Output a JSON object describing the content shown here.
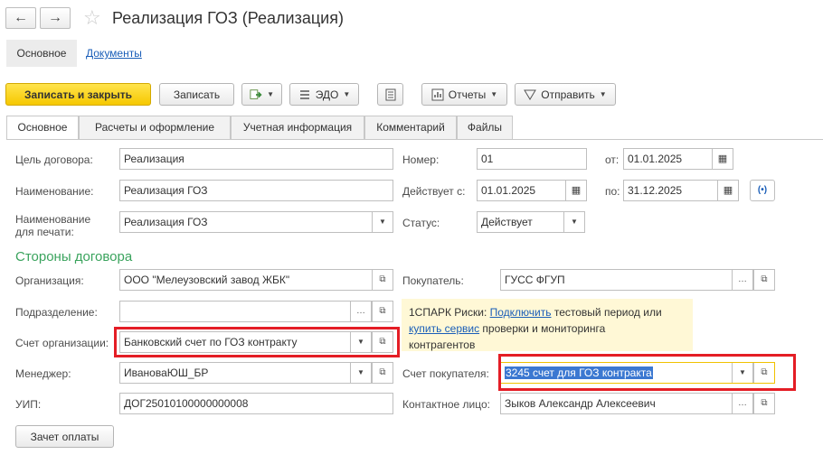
{
  "window": {
    "title": "Реализация ГОЗ (Реализация)",
    "back_icon": "←",
    "forward_icon": "→"
  },
  "topnav": {
    "main": "Основное",
    "documents": "Документы"
  },
  "toolbar": {
    "save_close": "Записать и закрыть",
    "save": "Записать",
    "edo": "ЭДО",
    "reports": "Отчеты",
    "send": "Отправить"
  },
  "tabs": [
    "Основное",
    "Расчеты и оформление",
    "Учетная информация",
    "Комментарий",
    "Файлы"
  ],
  "form": {
    "goal_label": "Цель договора:",
    "goal_value": "Реализация",
    "name_label": "Наименование:",
    "name_value": "Реализация ГОЗ",
    "print_name_label_1": "Наименование",
    "print_name_label_2": "для печати:",
    "print_name_value": "Реализация ГОЗ",
    "number_label": "Номер:",
    "number_value": "01",
    "from_label": "от:",
    "from_value": "01.01.2025",
    "valid_label": "Действует с:",
    "valid_from": "01.01.2025",
    "to_label": "по:",
    "to_value": "31.12.2025",
    "status_label": "Статус:",
    "status_value": "Действует",
    "section_title": "Стороны договора",
    "org_label": "Организация:",
    "org_value": "ООО \"Мелеузовский завод ЖБК\"",
    "buyer_label": "Покупатель:",
    "buyer_value": "ГУСС ФГУП",
    "division_label": "Подразделение:",
    "division_value": "",
    "org_account_label": "Счет организации:",
    "org_account_value": "Банковский счет по ГОЗ контракту",
    "manager_label": "Менеджер:",
    "manager_value": "ИвановаЮШ_БР",
    "buyer_account_label": "Счет покупателя:",
    "buyer_account_value": "3245 счет для ГОЗ контракта",
    "uip_label": "УИП:",
    "uip_value": "ДОГ25010100000000008",
    "contact_label": "Контактное лицо:",
    "contact_value": "Зыков Александр Алексеевич",
    "payment_offset": "Зачет оплаты"
  },
  "spark": {
    "prefix": "1СПАРК Риски: ",
    "connect": "Подключить",
    "mid": " тестовый период или",
    "buy": "купить сервис",
    "rest": " проверки и мониторинга",
    "last": "контрагентов"
  },
  "colors": {
    "primary_button": "#f6c800",
    "section_title": "#3aa35d",
    "highlight_border": "#e41d25",
    "selection": "#3b78d1",
    "link": "#1a5eb8"
  }
}
